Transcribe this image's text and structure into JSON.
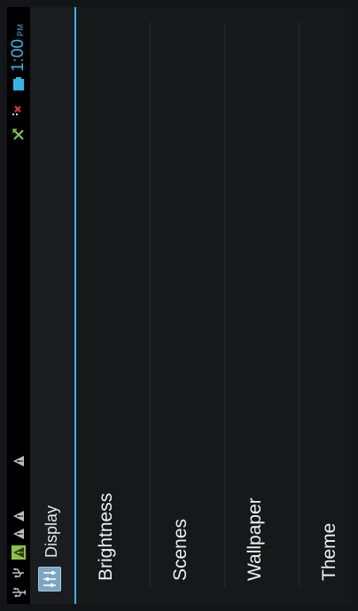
{
  "status_bar": {
    "time": "1:00",
    "ampm": "PM",
    "left_icons": [
      "usb-icon",
      "usb-icon",
      "android-debug-icon",
      "warning-icon",
      "warning-icon",
      "warning-icon"
    ],
    "right_icons": [
      "no-signal-icon",
      "no-data-icon",
      "battery-icon"
    ],
    "accent_color": "#33b5e5"
  },
  "action_bar": {
    "title": "Display",
    "icon": "display-settings-icon"
  },
  "settings": {
    "items": [
      {
        "label": "Brightness"
      },
      {
        "label": "Scenes"
      },
      {
        "label": "Wallpaper"
      },
      {
        "label": "Theme"
      }
    ]
  }
}
